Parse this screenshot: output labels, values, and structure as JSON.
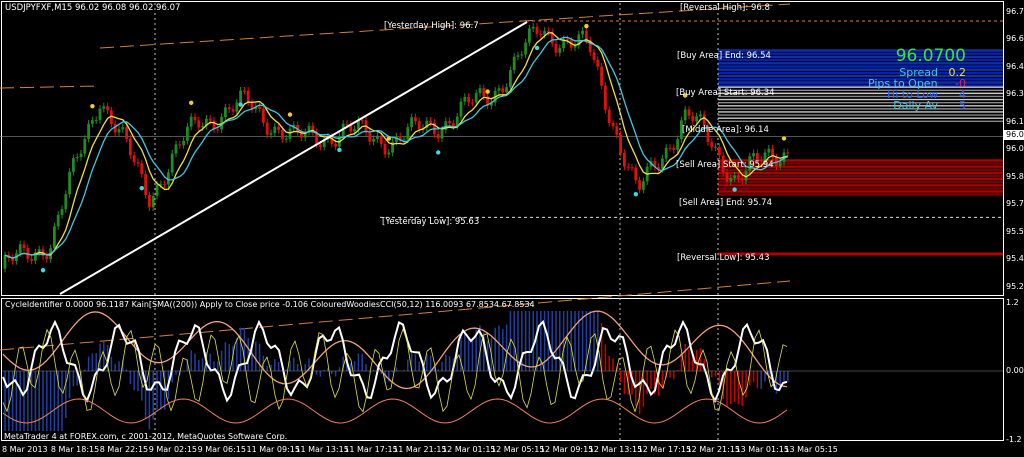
{
  "chart": {
    "symbol_header": "USDJPYFXF,M15  96.02 96.08 96.02 96.07",
    "price_axis": [
      "96.75",
      "96.60",
      "96.45",
      "96.30",
      "96.15",
      "96.00",
      "95.85",
      "95.70",
      "95.55",
      "95.40",
      "95.25"
    ],
    "current_price_tag": "96.07",
    "levels": {
      "reversal_high": "[Reversal High]: 96.8",
      "yesterday_high": "[Yesterday High]: 96.7",
      "buy_area_end": "[Buy Area] End: 96.54",
      "buy_area_start": "[Buy Area] Start: 96.34",
      "middle_area": "[Middle Area]: 96.14",
      "sell_area_start": "[Sell Area] Start: 95.94",
      "sell_area_end": "[Sell Area] End: 95.74",
      "yesterday_low": "[Yesterday Low]: 95.63",
      "reversal_low": "[Reversal Low]: 95.43"
    },
    "info_panel": {
      "price": "96.0700",
      "spread_label": "Spread",
      "spread_value": "0.2",
      "pips_label": "Pips to Open",
      "pips_value": "-0",
      "hilo_label": "Hi to Low",
      "hilo_value": "4",
      "daily_label": "Daily Av",
      "daily_value": "5"
    },
    "closes_at_time_labels": [
      95.35,
      95.5,
      96.3,
      95.75,
      96.15,
      96.25,
      96.05,
      96.1,
      96.05,
      96.15,
      96.3,
      96.65,
      96.55,
      95.75,
      96.2,
      95.85,
      96.0,
      96.07
    ]
  },
  "indicator": {
    "header": "CycleIdentifier 0.0000 96.1187  Kain[SMA((200)) Apply to Close price -0.106  ColouredWoodiesCCI(50,12) 116.0093 67.8534 67.8534",
    "axis": [
      "1.2",
      "0.00",
      "-1.2"
    ]
  },
  "footer": "MetaTrader 4 at FOREX.com, c 2001-2012, MetaQuotes Software Corp.",
  "time_axis": [
    "8 Mar 2013",
    "8 Mar 18:15",
    "8 Mar 22:15",
    "9 Mar 02:15",
    "9 Mar 06:15",
    "11 Mar 09:15",
    "11 Mar 13:15",
    "11 Mar 17:15",
    "11 Mar 21:15",
    "12 Mar 01:15",
    "12 Mar 05:15",
    "12 Mar 09:15",
    "12 Mar 13:15",
    "12 Mar 17:15",
    "12 Mar 21:15",
    "13 Mar 01:15",
    "13 Mar 05:15"
  ],
  "colors": {
    "bull": "#1e8c1e",
    "bear": "#e01010",
    "buy_zone": "#0a1a9a",
    "sell_zone": "#a00000",
    "ma_fast": "#f0e040",
    "ma_slow": "#40c8e0",
    "price_green": "#40e040"
  }
}
